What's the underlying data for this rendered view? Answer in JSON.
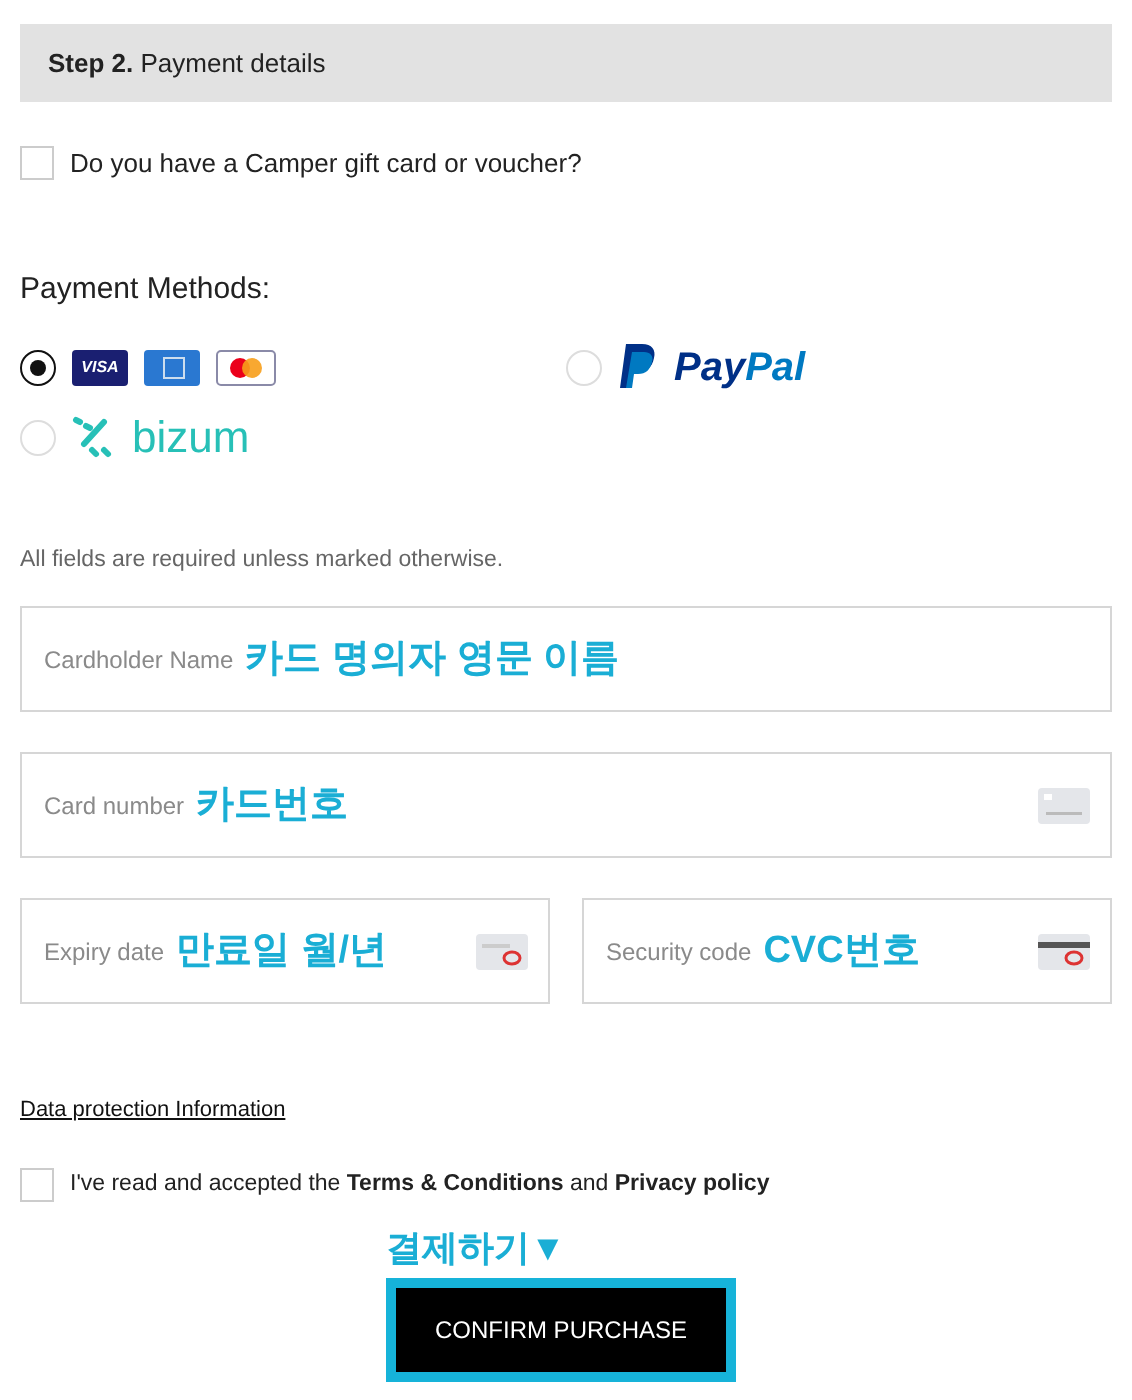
{
  "step": {
    "number": "Step 2.",
    "title": "Payment details"
  },
  "gift_card": {
    "label": "Do you have a Camper gift card or voucher?",
    "checked": false
  },
  "payment_title": "Payment Methods:",
  "methods": [
    {
      "kind": "cards",
      "selected": true,
      "logos": [
        "VISA"
      ]
    },
    {
      "kind": "paypal",
      "selected": false,
      "logos": [
        "Pay",
        "Pal"
      ]
    },
    {
      "kind": "bizum",
      "selected": false,
      "logos": [
        "bizum"
      ]
    }
  ],
  "required_note": "All fields are required unless marked otherwise.",
  "fields": [
    {
      "kind": "name",
      "label": "Cardholder Name",
      "annotation": "카드 명의자 영문 이름"
    },
    {
      "kind": "number",
      "label": "Card number",
      "annotation": "카드번호"
    },
    {
      "kind": "expiry",
      "label": "Expiry date",
      "annotation": "만료일 월/년"
    },
    {
      "kind": "cvc",
      "label": "Security code",
      "annotation": "CVC번호"
    }
  ],
  "data_protection": "Data protection Information",
  "terms": {
    "checked": false,
    "text": "I've read and accepted the **Terms & Conditions** and **Privacy policy**"
  },
  "confirm": {
    "annotation": "결제하기▼",
    "label": "CONFIRM PURCHASE",
    "highlighted": true
  }
}
